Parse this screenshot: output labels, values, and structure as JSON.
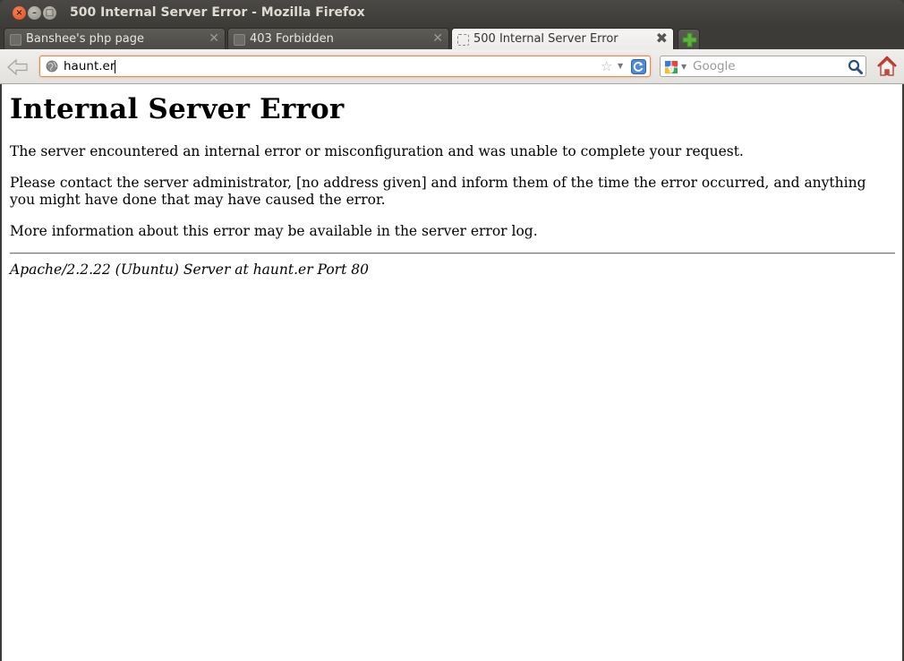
{
  "window": {
    "title": "500 Internal Server Error - Mozilla Firefox",
    "controls": {
      "close": "×",
      "minimize": "–",
      "maximize": "□"
    }
  },
  "tabs": [
    {
      "label": "Banshee's php page",
      "active": false
    },
    {
      "label": "403 Forbidden",
      "active": false
    },
    {
      "label": "500 Internal Server Error",
      "active": true
    }
  ],
  "tab_close_glyph": "✕",
  "active_tab_close_glyph": "✖",
  "navbar": {
    "url": "haunt.er",
    "search_placeholder": "Google",
    "star_glyph": "☆",
    "dropdown_glyph": "▼"
  },
  "page": {
    "heading": "Internal Server Error",
    "paragraphs": [
      "The server encountered an internal error or misconfiguration and was unable to complete your request.",
      "Please contact the server administrator, [no address given] and inform them of the time the error occurred, and anything you might have done that may have caused the error.",
      "More information about this error may be available in the server error log."
    ],
    "signature": "Apache/2.2.22 (Ubuntu) Server at haunt.er Port 80"
  },
  "colors": {
    "titlebar": "#3c3b37",
    "close_button": "#df4a16",
    "url_focus_border": "#e88a5a",
    "reload_blue": "#3a78c9",
    "home_red": "#c8453a",
    "newtab_green": "#5bb53b"
  }
}
